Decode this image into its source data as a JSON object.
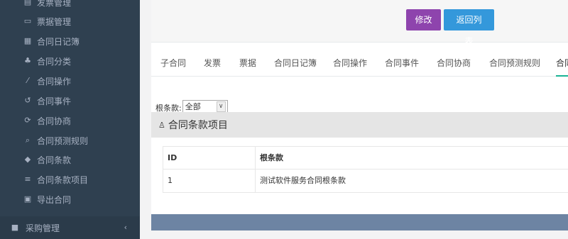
{
  "sidebar": {
    "sub_items": [
      {
        "label": "发票管理",
        "icon": "file-icon",
        "glyph": "▤"
      },
      {
        "label": "票据管理",
        "icon": "ticket-icon",
        "glyph": "▭"
      },
      {
        "label": "合同日记簿",
        "icon": "calendar-icon",
        "glyph": "▦"
      },
      {
        "label": "合同分类",
        "icon": "cubes-icon",
        "glyph": "♣"
      },
      {
        "label": "合同操作",
        "icon": "wand-icon",
        "glyph": "⁄"
      },
      {
        "label": "合同事件",
        "icon": "undo-icon",
        "glyph": "↺"
      },
      {
        "label": "合同协商",
        "icon": "refresh-icon",
        "glyph": "⟳"
      },
      {
        "label": "合同预测规则",
        "icon": "search-icon",
        "glyph": "⌕"
      },
      {
        "label": "合同条款",
        "icon": "tag-icon",
        "glyph": "◆"
      },
      {
        "label": "合同条款项目",
        "icon": "list-icon",
        "glyph": "≡"
      },
      {
        "label": "导出合同",
        "icon": "export-icon",
        "glyph": "▣"
      }
    ],
    "top_item": {
      "label": "采购管理",
      "glyph": "■",
      "chevron": "‹"
    }
  },
  "toolbar": {
    "edit_label": "修改",
    "back_label": "返回列表"
  },
  "tabs": [
    {
      "label": "子合同"
    },
    {
      "label": "发票"
    },
    {
      "label": "票据"
    },
    {
      "label": "合同日记簿"
    },
    {
      "label": "合同操作"
    },
    {
      "label": "合同事件"
    },
    {
      "label": "合同协商"
    },
    {
      "label": "合同预测规则"
    },
    {
      "label": "合同"
    }
  ],
  "filter": {
    "label": "根条款:",
    "selected": "全部",
    "arrow": "∨"
  },
  "section": {
    "title": "合同条款项目",
    "icon_glyph": "♙"
  },
  "table": {
    "columns": [
      "ID",
      "根条款"
    ],
    "rows": [
      [
        "1",
        "测试软件服务合同根条款"
      ]
    ]
  }
}
